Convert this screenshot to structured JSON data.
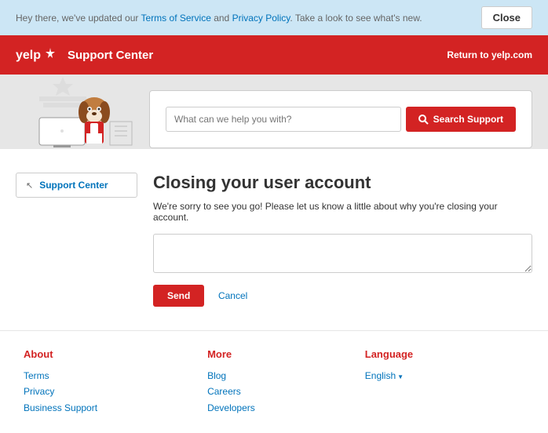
{
  "notice": {
    "text_before": "Hey there, we've updated our ",
    "tos": "Terms of Service",
    "and": " and ",
    "privacy": "Privacy Policy",
    "text_after": ". Take a look to see what's new.",
    "close": "Close"
  },
  "header": {
    "logo_text": "yelp",
    "title": "Support Center",
    "return": "Return to yelp.com"
  },
  "search": {
    "placeholder": "What can we help you with?",
    "button": "Search Support"
  },
  "breadcrumb": {
    "label": "Support Center"
  },
  "main": {
    "title": "Closing your user account",
    "subtitle": "We're sorry to see you go! Please let us know a little about why you're closing your account.",
    "send": "Send",
    "cancel": "Cancel"
  },
  "footer": {
    "about": {
      "heading": "About",
      "links": [
        "Terms",
        "Privacy",
        "Business Support"
      ]
    },
    "more": {
      "heading": "More",
      "links": [
        "Blog",
        "Careers",
        "Developers"
      ]
    },
    "language": {
      "heading": "Language",
      "current": "English"
    }
  }
}
